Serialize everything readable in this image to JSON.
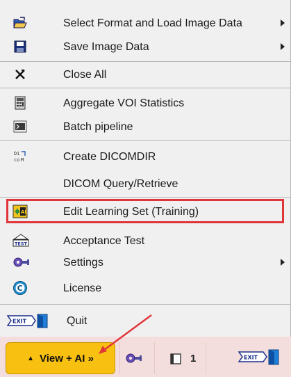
{
  "menu": {
    "items": [
      {
        "label": "Select Format and Load Image Data",
        "icon": "folder-open-icon",
        "submenu": true
      },
      {
        "label": "Save Image Data",
        "icon": "floppy-disk-icon",
        "submenu": true
      },
      {
        "label": "Close All",
        "icon": "close-all-icon",
        "submenu": false
      },
      {
        "label": "Aggregate VOI Statistics",
        "icon": "statistics-icon",
        "submenu": false
      },
      {
        "label": "Batch pipeline",
        "icon": "terminal-icon",
        "submenu": false
      },
      {
        "label": "Create DICOMDIR",
        "icon": "dicom-icon",
        "submenu": false
      },
      {
        "label": "DICOM Query/Retrieve",
        "icon": "",
        "submenu": false
      },
      {
        "label": "Edit Learning Set (Training)",
        "icon": "ai-learning-icon",
        "submenu": false,
        "highlighted": true
      },
      {
        "label": "Acceptance Test",
        "icon": "test-icon",
        "submenu": false,
        "icon_text": "TEST"
      },
      {
        "label": "Settings",
        "icon": "settings-icon",
        "submenu": true
      },
      {
        "label": "License",
        "icon": "license-icon",
        "submenu": false,
        "icon_text": "C"
      },
      {
        "label": "Quit",
        "icon": "exit-icon",
        "submenu": false,
        "icon_text": "EXIT"
      }
    ]
  },
  "toolbar": {
    "view_button_label": "View + AI »",
    "count": "1",
    "exit_icon_text": "EXIT"
  },
  "colors": {
    "highlight_border": "#e0363a",
    "annotation_arrow": "#e0363a",
    "view_button": "#f8c010",
    "toolbar_bg": "#f4dedd"
  }
}
